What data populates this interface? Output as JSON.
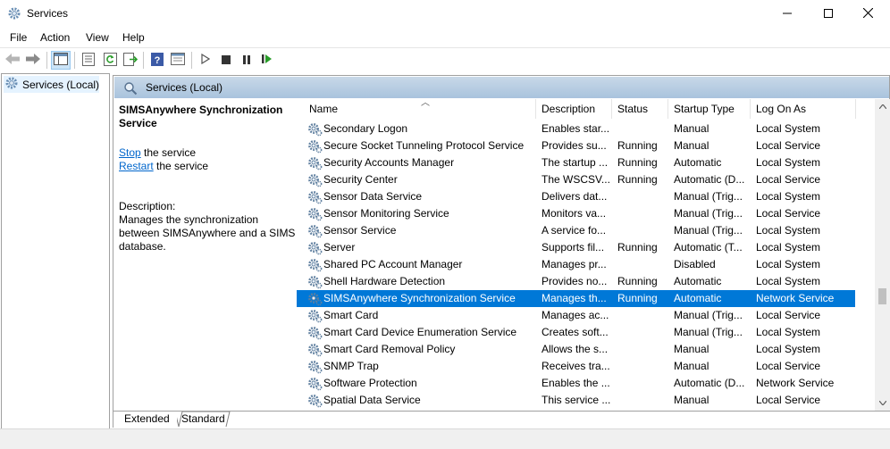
{
  "window": {
    "title": "Services",
    "icon": "services-gear-icon",
    "controls": [
      "minimize-icon",
      "maximize-icon",
      "close-icon"
    ]
  },
  "menu": [
    "File",
    "Action",
    "View",
    "Help"
  ],
  "toolbar": {
    "icons": [
      "back-arrow-icon",
      "forward-arrow-icon",
      "show-hide-tree-icon",
      "properties-icon",
      "refresh-icon",
      "export-list-icon",
      "help-icon",
      "console-view-icon",
      "play-icon",
      "stop-icon",
      "pause-icon",
      "restart-icon"
    ]
  },
  "tree": {
    "root_label": "Services (Local)"
  },
  "pane": {
    "header_title": "Services (Local)",
    "selected_service_title": "SIMSAnywhere Synchronization Service",
    "action_stop_link": "Stop",
    "action_stop_suffix": " the service",
    "action_restart_link": "Restart",
    "action_restart_suffix": " the service",
    "description_label": "Description:",
    "description_text": "Manages the synchronization between SIMSAnywhere and a SIMS database."
  },
  "table": {
    "columns": [
      "Name",
      "Description",
      "Status",
      "Startup Type",
      "Log On As"
    ],
    "rows": [
      {
        "name": "Secondary Logon",
        "description": "Enables star...",
        "status": "",
        "startup": "Manual",
        "logon": "Local System"
      },
      {
        "name": "Secure Socket Tunneling Protocol Service",
        "description": "Provides su...",
        "status": "Running",
        "startup": "Manual",
        "logon": "Local Service"
      },
      {
        "name": "Security Accounts Manager",
        "description": "The startup ...",
        "status": "Running",
        "startup": "Automatic",
        "logon": "Local System"
      },
      {
        "name": "Security Center",
        "description": "The WSCSV...",
        "status": "Running",
        "startup": "Automatic (D...",
        "logon": "Local Service"
      },
      {
        "name": "Sensor Data Service",
        "description": "Delivers dat...",
        "status": "",
        "startup": "Manual (Trig...",
        "logon": "Local System"
      },
      {
        "name": "Sensor Monitoring Service",
        "description": "Monitors va...",
        "status": "",
        "startup": "Manual (Trig...",
        "logon": "Local Service"
      },
      {
        "name": "Sensor Service",
        "description": "A service fo...",
        "status": "",
        "startup": "Manual (Trig...",
        "logon": "Local System"
      },
      {
        "name": "Server",
        "description": "Supports fil...",
        "status": "Running",
        "startup": "Automatic (T...",
        "logon": "Local System"
      },
      {
        "name": "Shared PC Account Manager",
        "description": "Manages pr...",
        "status": "",
        "startup": "Disabled",
        "logon": "Local System"
      },
      {
        "name": "Shell Hardware Detection",
        "description": "Provides no...",
        "status": "Running",
        "startup": "Automatic",
        "logon": "Local System"
      },
      {
        "name": "SIMSAnywhere Synchronization Service",
        "description": "Manages th...",
        "status": "Running",
        "startup": "Automatic",
        "logon": "Network Service",
        "selected": true
      },
      {
        "name": "Smart Card",
        "description": "Manages ac...",
        "status": "",
        "startup": "Manual (Trig...",
        "logon": "Local Service"
      },
      {
        "name": "Smart Card Device Enumeration Service",
        "description": "Creates soft...",
        "status": "",
        "startup": "Manual (Trig...",
        "logon": "Local System"
      },
      {
        "name": "Smart Card Removal Policy",
        "description": "Allows the s...",
        "status": "",
        "startup": "Manual",
        "logon": "Local System"
      },
      {
        "name": "SNMP Trap",
        "description": "Receives tra...",
        "status": "",
        "startup": "Manual",
        "logon": "Local Service"
      },
      {
        "name": "Software Protection",
        "description": "Enables the ...",
        "status": "",
        "startup": "Automatic (D...",
        "logon": "Network Service"
      },
      {
        "name": "Spatial Data Service",
        "description": "This service ...",
        "status": "",
        "startup": "Manual",
        "logon": "Local Service"
      }
    ]
  },
  "tabs": [
    "Extended",
    "Standard"
  ],
  "colors": {
    "selection": "#0078d7",
    "link": "#0066cc",
    "header_gradient_top": "#c8d8e8",
    "header_gradient_bottom": "#a9c3dd"
  }
}
